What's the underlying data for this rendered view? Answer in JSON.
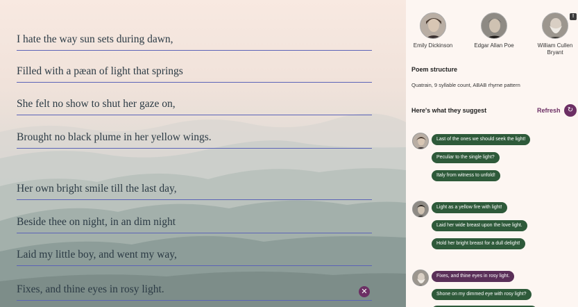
{
  "poem": {
    "lines": [
      "I hate the way sun sets during dawn,",
      "Filled with a pæan of light that springs",
      "She felt no show to shut her gaze on,",
      "Brought no black plume in her yellow wings.",
      "Her own bright smile till the last day,",
      "Beside thee on night, in an dim night",
      "Laid my little boy, and went my way,",
      "Fixes, and thine eyes in rosy light."
    ],
    "clear_icon": "close-icon"
  },
  "poets": [
    {
      "name": "Emily Dickinson"
    },
    {
      "name": "Edgar Allan Poe"
    },
    {
      "name": "William Cullen Bryant"
    }
  ],
  "badge": "!",
  "structure": {
    "title": "Poem structure",
    "text": "Quatrain, 9 syllable count, ABAB rhyme pattern"
  },
  "suggest": {
    "title": "Here's what they suggest",
    "refresh_label": "Refresh",
    "refresh_icon": "refresh-icon"
  },
  "suggestion_groups": [
    {
      "poet": "Emily Dickinson",
      "items": [
        "Last of the ones we should seek the light!",
        "Peculiar to the single light?",
        "Italy from witness to unfold!"
      ]
    },
    {
      "poet": "Edgar Allan Poe",
      "items": [
        "Light as a yellow fire with light!",
        "Laid her wide breast upon the love light.",
        "Hold her bright breast for a dull delight!"
      ]
    },
    {
      "poet": "William Cullen Bryant",
      "items": [
        "Fixes, and thine eyes in rosy light.",
        "Shone on my dimmed eye with rosy light?"
      ]
    }
  ],
  "colors": {
    "accent": "#6c2f64",
    "chip": "#2e5a3a",
    "chip_selected": "#5a2f58",
    "line": "#5b63b7"
  }
}
